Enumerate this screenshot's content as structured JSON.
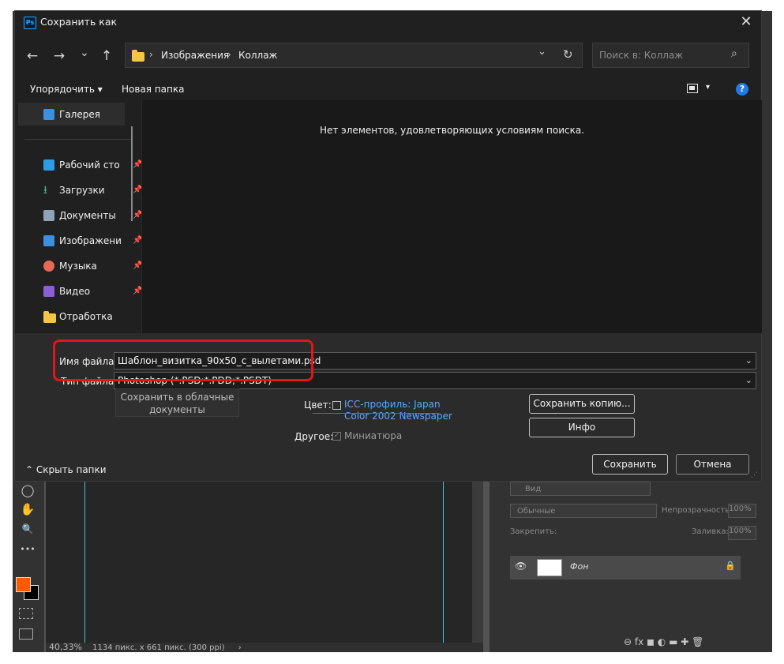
{
  "dialog": {
    "title": "Сохранить как",
    "close_glyph": "✕",
    "nav": {
      "back_glyph": "←",
      "forward_glyph": "→",
      "recent_glyph": "⌄",
      "up_glyph": "↑"
    },
    "address": {
      "sep": "›",
      "crumbs": [
        "Изображения",
        "Коллаж"
      ],
      "refresh_glyph": "↻"
    },
    "search": {
      "placeholder": "Поиск в: Коллаж",
      "icon_glyph": "⌕"
    },
    "command_bar": {
      "organize": "Упорядочить ▾",
      "new_folder": "Новая папка",
      "view_arrow": "▾",
      "help": "?"
    },
    "sidebar": {
      "items": [
        {
          "label": "Галерея",
          "icon": "gallery-icon"
        },
        {
          "label": "Рабочий сто",
          "icon": "desktop-icon",
          "pinned": true
        },
        {
          "label": "Загрузки",
          "icon": "download-icon",
          "pinned": true
        },
        {
          "label": "Документы",
          "icon": "documents-icon",
          "pinned": true
        },
        {
          "label": "Изображени",
          "icon": "pictures-icon",
          "pinned": true
        },
        {
          "label": "Музыка",
          "icon": "music-icon",
          "pinned": true
        },
        {
          "label": "Видео",
          "icon": "video-icon",
          "pinned": true
        },
        {
          "label": "Отработка",
          "icon": "folder-icon"
        }
      ],
      "pin_glyph": "📌"
    },
    "content": {
      "empty_message": "Нет элементов, удовлетворяющих условиям поиска."
    },
    "filename": {
      "label": "Имя файла:",
      "value": "Шаблон_визитка_90x50_с_вылетами.psd"
    },
    "filetype": {
      "label": "Тип файла:",
      "value": "Photoshop (*.PSD;*.PDD;*.PSDT)"
    },
    "dropdown_glyph": "⌄",
    "cloud_save": {
      "line1": "Сохранить в облачные",
      "line2": "документы"
    },
    "color": {
      "label": "Цвет:",
      "icc_line1": "ICC-профиль:  Japan",
      "icc_line2": "Color 2002 Newspaper"
    },
    "other": {
      "label": "Другое:",
      "thumbnail": "Миниатюра",
      "check_glyph": "✓"
    },
    "buttons": {
      "save_copy": "Сохранить копию...",
      "info": "Инфо",
      "save": "Сохранить",
      "cancel": "Отмена",
      "hide_folders": "Скрыть папки",
      "hide_glyph": "⌃"
    },
    "colors": {
      "accent_link": "#5ea8ff",
      "highlight": "#e11616",
      "help": "#1d7ce5"
    }
  },
  "photoshop": {
    "tools": [
      "◯",
      "✋",
      "🔍",
      "•••"
    ],
    "status_zoom": "40,33%",
    "status_info": "1134 пикс. x 661 пикс. (300 ppi)",
    "status_arrow": "›",
    "layers_panel": {
      "search_placeholder": "Вид",
      "blend_mode": "Обычные",
      "opacity_label": "Непрозрачность:",
      "opacity_value": "100%",
      "lock_label": "Закрепить:",
      "fill_label": "Заливка:",
      "fill_value": "100%",
      "layer_name": "Фон",
      "bottom_icons": "⊖  fx  ◼  ◐  ▬  ✚  🗑"
    },
    "foreground_color": "#ff5a00",
    "guide_color": "#39c6d6"
  }
}
